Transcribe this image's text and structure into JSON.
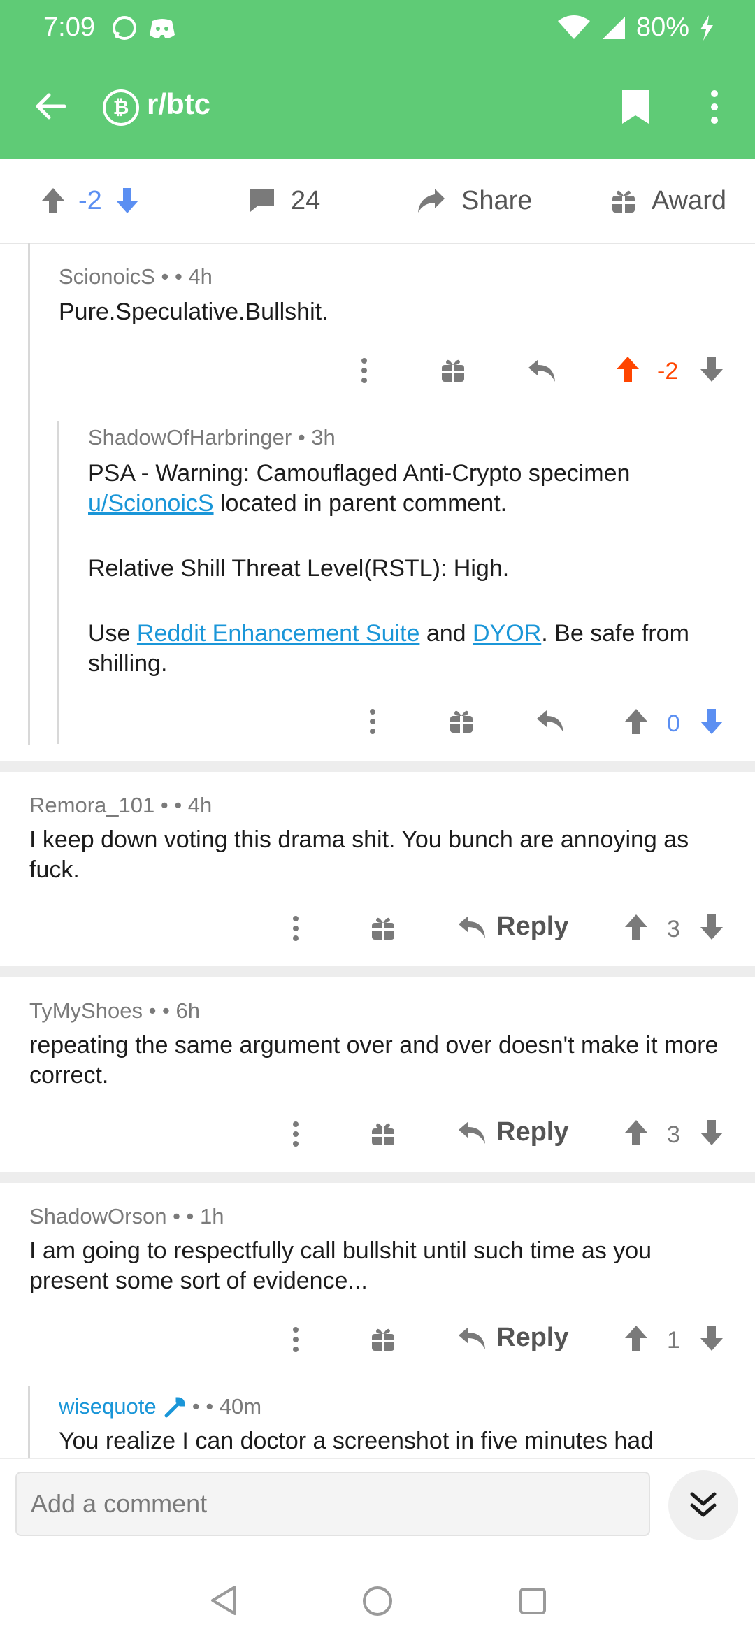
{
  "status": {
    "time": "7:09",
    "battery": "80%"
  },
  "appbar": {
    "subreddit": "r/btc"
  },
  "post_actions": {
    "score": "-2",
    "comments": "24",
    "share": "Share",
    "award": "Award"
  },
  "comments": [
    {
      "author": "ScionoicS",
      "dot": " • ",
      "time": "• 4h",
      "body": "Pure.Speculative.Bullshit.",
      "score": "-2"
    },
    {
      "author": "ShadowOfHarbringer",
      "time": " • 3h",
      "p1_a": "PSA - Warning: Camouflaged Anti-Crypto specimen ",
      "p1_link": "u/ScionoicS",
      "p1_b": " located in parent comment.",
      "p2": "Relative Shill Threat Level(RSTL): High.",
      "p3_a": "Use ",
      "p3_link1": "Reddit Enhancement Suite",
      "p3_b": " and ",
      "p3_link2": "DYOR",
      "p3_c": ". Be safe from shilling.",
      "score": "0"
    },
    {
      "author": "Remora_101",
      "dot": " • ",
      "time": "• 4h",
      "body": "I keep down voting this drama shit. You bunch are annoying as fuck.",
      "score": "3",
      "reply": "Reply"
    },
    {
      "author": "TyMyShoes",
      "dot": " • ",
      "time": "• 6h",
      "body": "repeating the same argument over and over doesn't make it more correct.",
      "score": "3",
      "reply": "Reply"
    },
    {
      "author": "ShadowOrson",
      "dot": " • ",
      "time": "• 1h",
      "body": "I am going to respectfully call bullshit until such time as you present some sort of evidence...",
      "score": "1",
      "reply": "Reply"
    },
    {
      "author": "wisequote",
      "dot": " • ",
      "time": "• 40m",
      "body": "You realize I can doctor a screenshot in five minutes had"
    }
  ],
  "composer": {
    "placeholder": "Add a comment"
  },
  "colors": {
    "header": "#5fcb76",
    "upvote": "#ff4500",
    "downvote": "#5b8ff2",
    "link": "#1a96d8"
  }
}
